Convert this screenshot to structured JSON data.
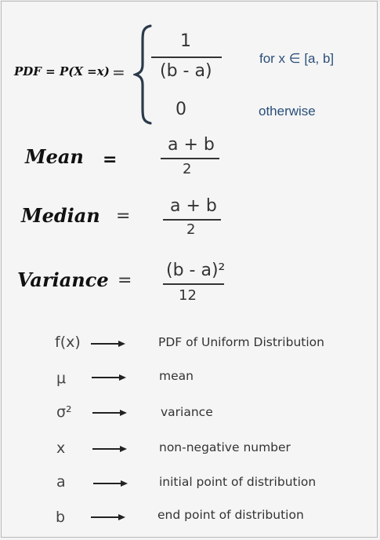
{
  "pdf": {
    "label": "PDF = P(X =x)",
    "equals": "=",
    "case1_numerator": "1",
    "case1_denominator": "(b - a)",
    "case1_condition": "for x ∈ [a, b]",
    "case2_value": "0",
    "case2_condition": "otherwise"
  },
  "mean": {
    "label": "Mean",
    "equals": "=",
    "numerator": "a + b",
    "denominator": "2"
  },
  "median": {
    "label": "Median",
    "equals": "=",
    "numerator": "a + b",
    "denominator": "2"
  },
  "variance": {
    "label": "Variance",
    "equals": "=",
    "numerator": "(b - a)²",
    "denominator": "12"
  },
  "legend": [
    {
      "symbol": "f(x)",
      "description": "PDF of Uniform Distribution"
    },
    {
      "symbol": "μ",
      "description": "mean"
    },
    {
      "symbol": "σ²",
      "description": "variance"
    },
    {
      "symbol": "x",
      "description": "non-negative number"
    },
    {
      "symbol": "a",
      "description": "initial point of distribution"
    },
    {
      "symbol": "b",
      "description": "end point of distribution"
    }
  ],
  "colors": {
    "condition_text": "#2a4f7a",
    "arrow": "#222222"
  },
  "icons": {
    "legend_arrow": "right-arrow-icon"
  }
}
